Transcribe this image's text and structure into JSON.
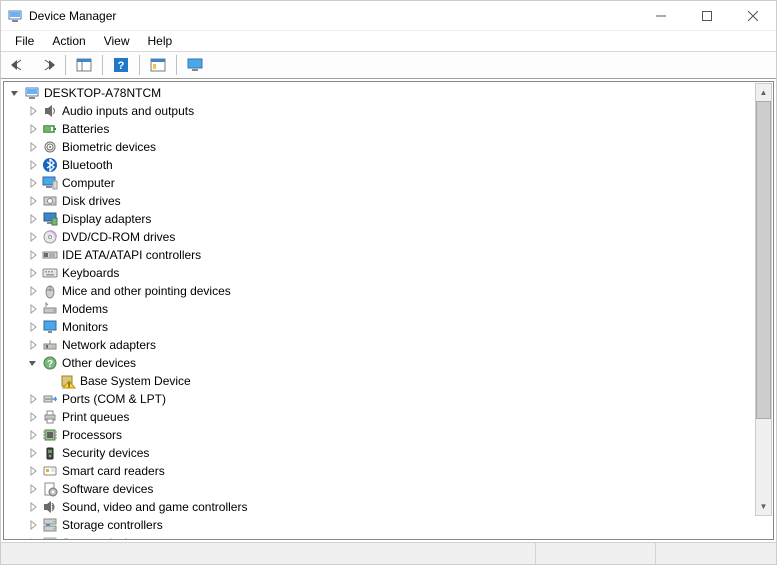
{
  "window": {
    "title": "Device Manager"
  },
  "menubar": {
    "items": [
      "File",
      "Action",
      "View",
      "Help"
    ]
  },
  "tree": {
    "root": {
      "label": "DESKTOP-A78NTCM",
      "expanded": true
    },
    "categories": [
      {
        "label": "Audio inputs and outputs",
        "icon": "speaker",
        "expanded": false
      },
      {
        "label": "Batteries",
        "icon": "battery",
        "expanded": false
      },
      {
        "label": "Biometric devices",
        "icon": "fingerprint",
        "expanded": false
      },
      {
        "label": "Bluetooth",
        "icon": "bluetooth",
        "expanded": false
      },
      {
        "label": "Computer",
        "icon": "computer",
        "expanded": false
      },
      {
        "label": "Disk drives",
        "icon": "disk",
        "expanded": false
      },
      {
        "label": "Display adapters",
        "icon": "display",
        "expanded": false
      },
      {
        "label": "DVD/CD-ROM drives",
        "icon": "dvd",
        "expanded": false
      },
      {
        "label": "IDE ATA/ATAPI controllers",
        "icon": "ide",
        "expanded": false
      },
      {
        "label": "Keyboards",
        "icon": "keyboard",
        "expanded": false
      },
      {
        "label": "Mice and other pointing devices",
        "icon": "mouse",
        "expanded": false
      },
      {
        "label": "Modems",
        "icon": "modem",
        "expanded": false
      },
      {
        "label": "Monitors",
        "icon": "monitor",
        "expanded": false
      },
      {
        "label": "Network adapters",
        "icon": "network",
        "expanded": false
      },
      {
        "label": "Other devices",
        "icon": "other",
        "expanded": true,
        "children": [
          {
            "label": "Base System Device",
            "icon": "warning"
          }
        ]
      },
      {
        "label": "Ports (COM & LPT)",
        "icon": "port",
        "expanded": false
      },
      {
        "label": "Print queues",
        "icon": "printer",
        "expanded": false
      },
      {
        "label": "Processors",
        "icon": "cpu",
        "expanded": false
      },
      {
        "label": "Security devices",
        "icon": "security",
        "expanded": false
      },
      {
        "label": "Smart card readers",
        "icon": "smartcard",
        "expanded": false
      },
      {
        "label": "Software devices",
        "icon": "software",
        "expanded": false
      },
      {
        "label": "Sound, video and game controllers",
        "icon": "sound",
        "expanded": false
      },
      {
        "label": "Storage controllers",
        "icon": "storage",
        "expanded": false
      },
      {
        "label": "System devices",
        "icon": "system",
        "expanded": false
      }
    ]
  }
}
